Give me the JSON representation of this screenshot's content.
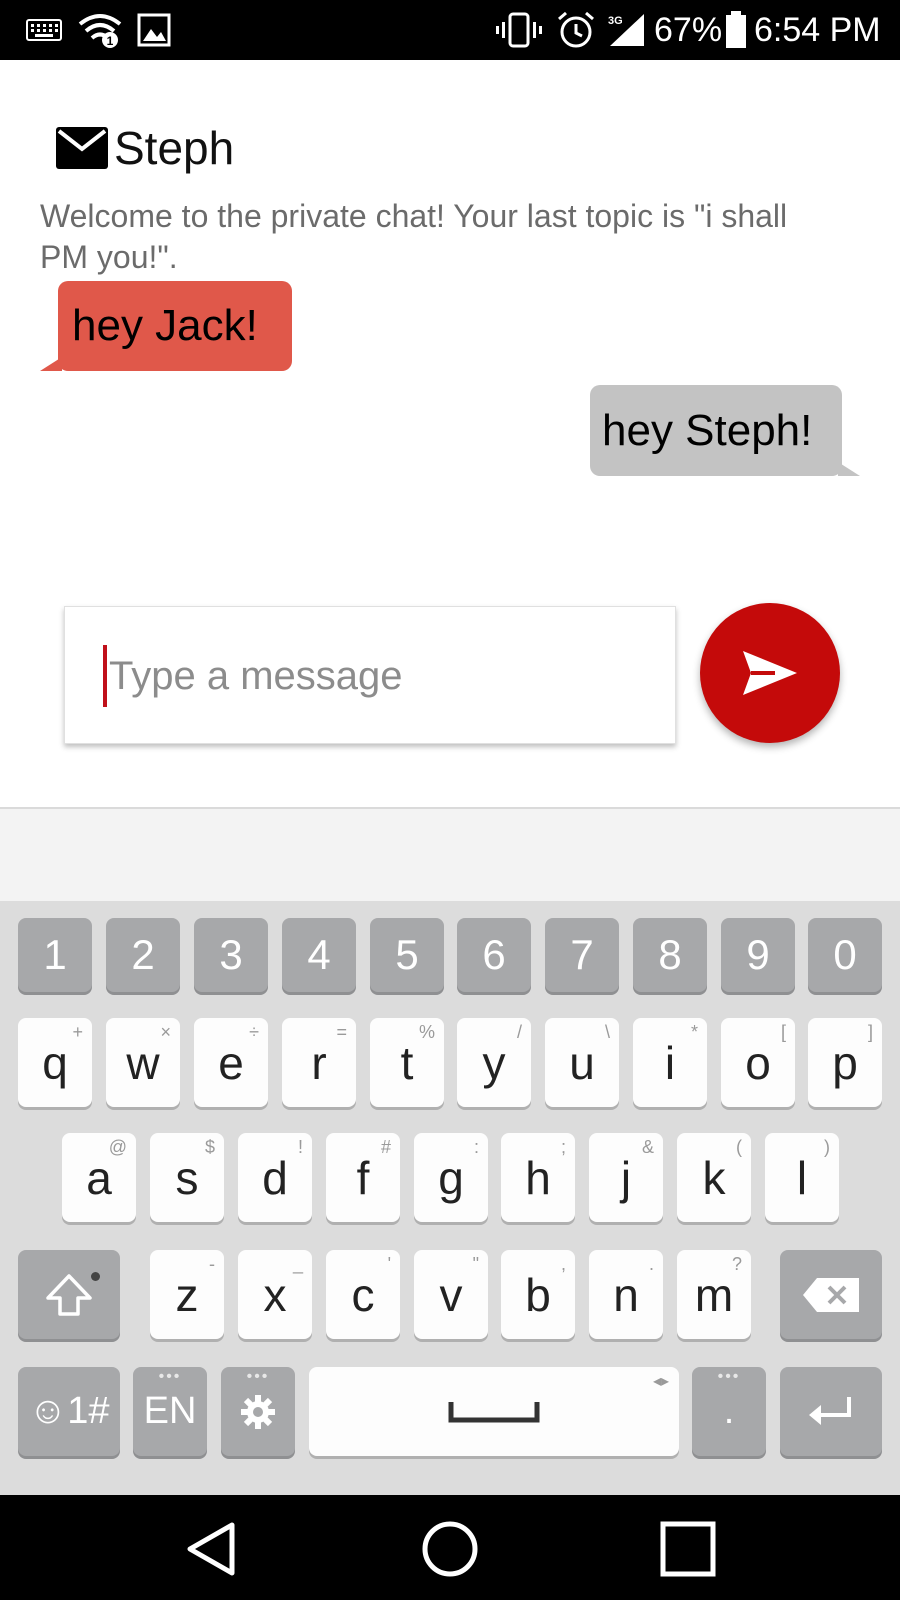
{
  "status_bar": {
    "battery": "67%",
    "time": "6:54 PM",
    "network_type": "3G",
    "icons": [
      "keyboard-icon",
      "wifi-icon",
      "image-icon",
      "vibrate-icon",
      "alarm-icon",
      "signal-icon",
      "battery-icon"
    ]
  },
  "chat": {
    "title": "Steph",
    "header_icon": "mail-icon",
    "welcome_text": "Welcome to the private chat! Your last topic is \"i shall PM you!\".",
    "messages": [
      {
        "direction": "incoming",
        "text": "hey Jack!",
        "color": "#e0584a"
      },
      {
        "direction": "outgoing",
        "text": "hey Steph!",
        "color": "#c3c3c3"
      }
    ]
  },
  "composer": {
    "placeholder": "Type a message",
    "value": "",
    "send_icon": "send-icon",
    "send_color": "#c40a0a"
  },
  "keyboard": {
    "numbers": [
      "1",
      "2",
      "3",
      "4",
      "5",
      "6",
      "7",
      "8",
      "9",
      "0"
    ],
    "row1": [
      {
        "k": "q",
        "s": "+"
      },
      {
        "k": "w",
        "s": "×"
      },
      {
        "k": "e",
        "s": "÷"
      },
      {
        "k": "r",
        "s": "="
      },
      {
        "k": "t",
        "s": "%"
      },
      {
        "k": "y",
        "s": "/"
      },
      {
        "k": "u",
        "s": "\\"
      },
      {
        "k": "i",
        "s": "*"
      },
      {
        "k": "o",
        "s": "["
      },
      {
        "k": "p",
        "s": "]"
      }
    ],
    "row2": [
      {
        "k": "a",
        "s": "@"
      },
      {
        "k": "s",
        "s": "$"
      },
      {
        "k": "d",
        "s": "!"
      },
      {
        "k": "f",
        "s": "#"
      },
      {
        "k": "g",
        "s": ":"
      },
      {
        "k": "h",
        "s": ";"
      },
      {
        "k": "j",
        "s": "&"
      },
      {
        "k": "k",
        "s": "("
      },
      {
        "k": "l",
        "s": ")"
      }
    ],
    "row3": [
      {
        "k": "z",
        "s": "-"
      },
      {
        "k": "x",
        "s": "_"
      },
      {
        "k": "c",
        "s": "'"
      },
      {
        "k": "v",
        "s": "\""
      },
      {
        "k": "b",
        "s": ","
      },
      {
        "k": "n",
        "s": "."
      },
      {
        "k": "m",
        "s": "?"
      }
    ],
    "symbols_label": "☺1#",
    "language_label": "EN",
    "period_label": ".",
    "space_arrows": "◂▸",
    "long_press_dots": "•••"
  },
  "nav_bar": {
    "icons": [
      "back-icon",
      "home-icon",
      "recents-icon"
    ]
  }
}
